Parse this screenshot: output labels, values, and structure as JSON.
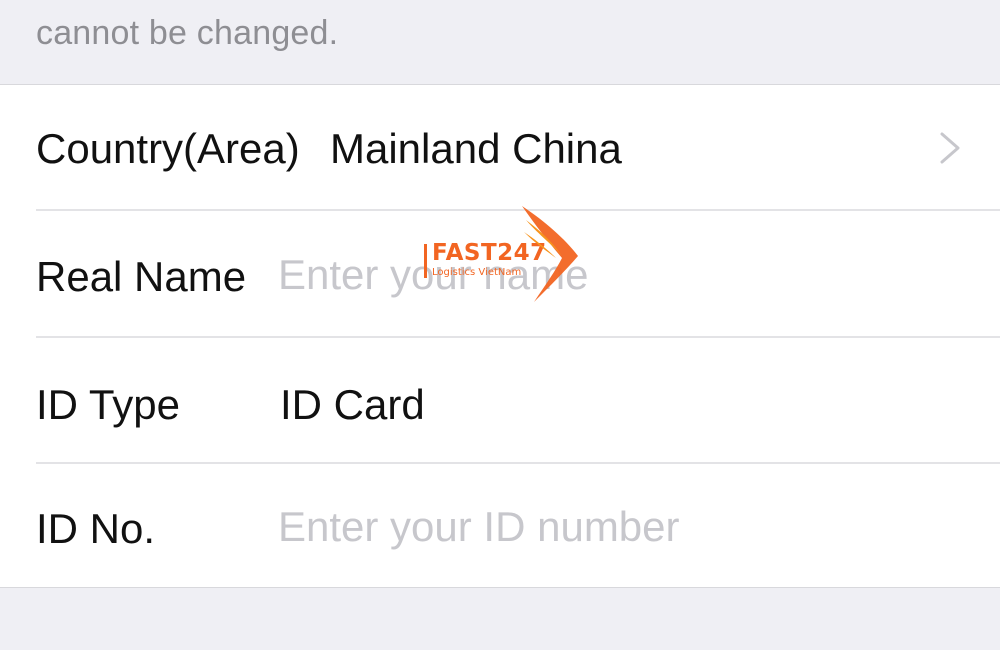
{
  "header": {
    "note_text": "cannot be changed."
  },
  "form": {
    "country_label": "Country(Area)",
    "country_value": "Mainland China",
    "real_name_label": "Real Name",
    "real_name_placeholder": "Enter your name",
    "id_type_label": "ID Type",
    "id_type_value": "ID Card",
    "id_no_label": "ID No.",
    "id_no_placeholder": "Enter your ID number"
  },
  "watermark": {
    "brand": "FAST247",
    "tagline": "Logistics VietNam",
    "color": "#f26522"
  },
  "icons": {
    "country_row": "chevron-right-icon"
  },
  "colors": {
    "background": "#efeff4",
    "cell": "#ffffff",
    "text": "#111111",
    "placeholder": "#c7c7cc",
    "secondary_text": "#8e8e93",
    "chevron": "#c7c7cc"
  }
}
